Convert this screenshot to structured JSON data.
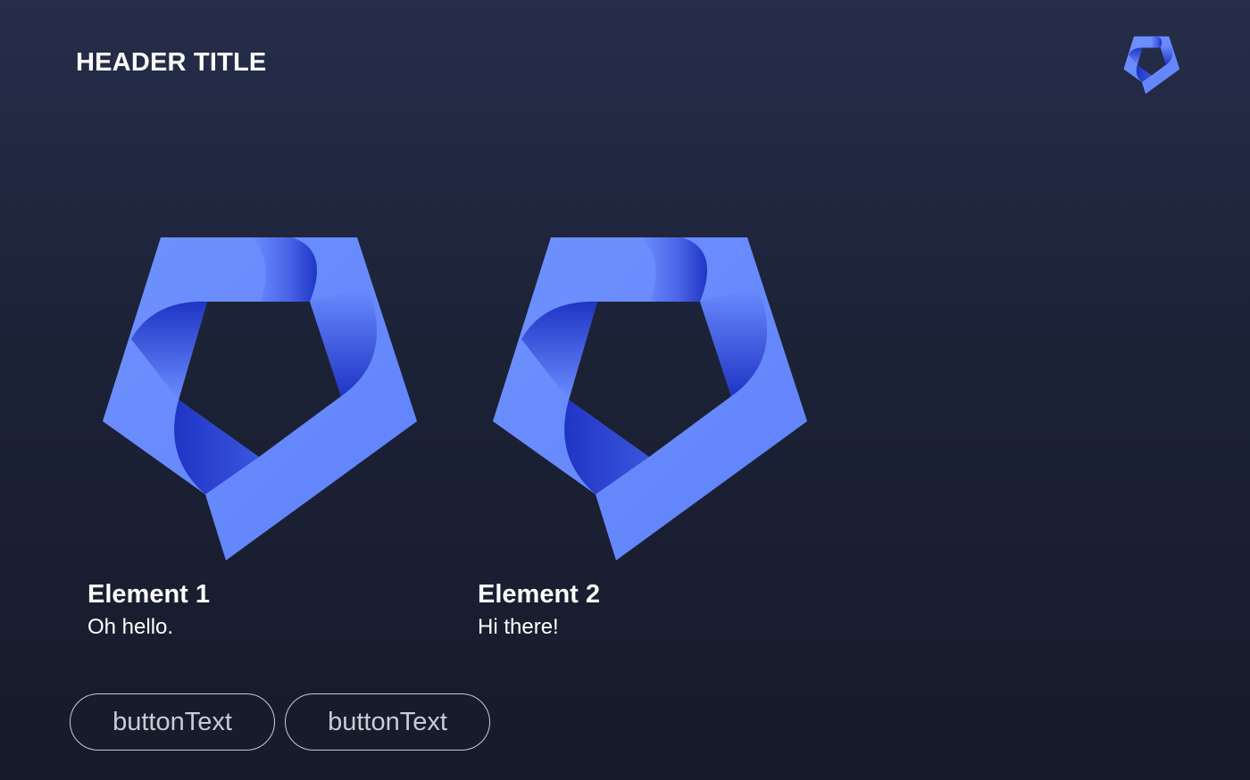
{
  "header": {
    "title": "HEADER TITLE",
    "logo_icon": "pentagon-ribbon-logo-icon"
  },
  "cards": [
    {
      "title": "Element 1",
      "subtitle": "Oh hello.",
      "image_icon": "pentagon-ribbon-logo-icon"
    },
    {
      "title": "Element 2",
      "subtitle": "Hi there!",
      "image_icon": "pentagon-ribbon-logo-icon"
    }
  ],
  "buttons": [
    {
      "label": "buttonText"
    },
    {
      "label": "buttonText"
    }
  ],
  "colors": {
    "background_top": "#252d4a",
    "background_bottom": "#161b2b",
    "logo_light": "#6a8cff",
    "logo_dark": "#1f35c4",
    "text": "#ffffff",
    "button_border": "#c7c9d1"
  }
}
